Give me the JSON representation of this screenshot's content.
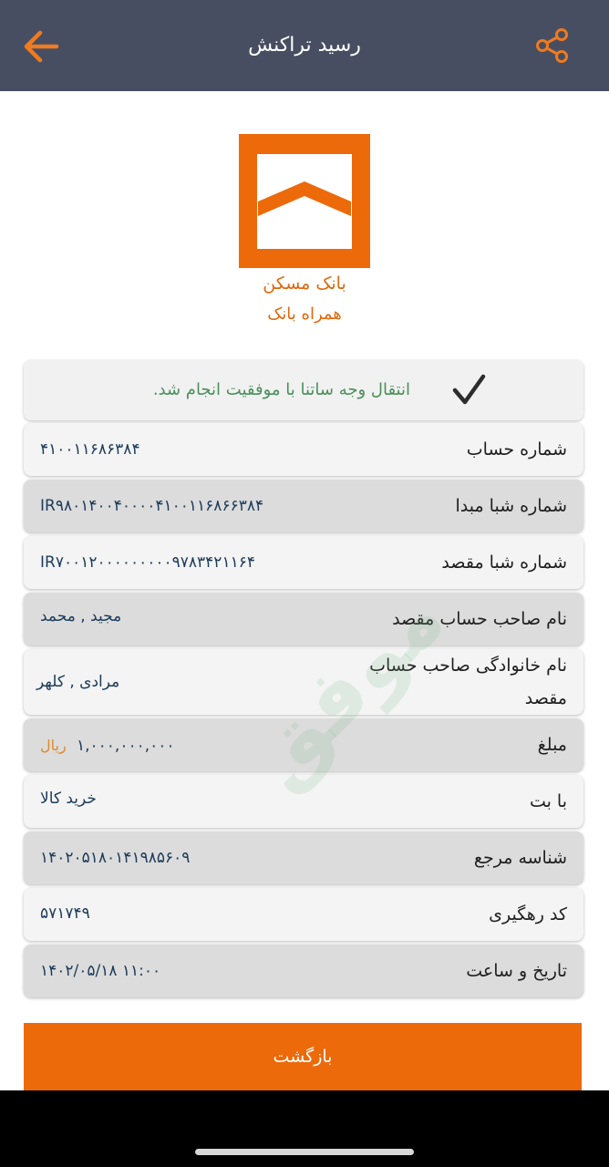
{
  "header": {
    "title": "رسید تراکنش",
    "back_icon": "arrow-left-icon",
    "share_icon": "share-icon"
  },
  "bank": {
    "name": "بانک  مسکن",
    "subtitle": "همراه بانک"
  },
  "status": {
    "message": "انتقال وجه ساتنا با موفقیت انجام شد.",
    "icon": "checkmark-icon"
  },
  "rows": [
    {
      "label": "شماره حساب",
      "value": "۴۱۰۰۱۱۶۸۶۳۸۴"
    },
    {
      "label": "شماره شبا مبدا",
      "value": "IR۹۸۰۱۴۰۰۴۰۰۰۰۴۱۰۰۱۱۶۸۶۶۳۸۴"
    },
    {
      "label": "شماره شبا مقصد",
      "value": "IR۷۰۰۱۲۰۰۰۰۰۰۰۰۰۹۷۸۳۴۲۱۱۶۴"
    },
    {
      "label": "نام صاحب حساب مقصد",
      "value": "مجید , محمد"
    },
    {
      "label": "نام خانوادگی صاحب حساب مقصد",
      "value": "مرادی , کلهر"
    },
    {
      "label": "مبلغ",
      "value": "۱,۰۰۰,۰۰۰,۰۰۰",
      "unit": "ریال"
    },
    {
      "label": "با بت",
      "value": "خرید کالا"
    },
    {
      "label": "شناسه مرجع",
      "value": "۱۴۰۲۰۵۱۸۰۱۴۱۹۸۵۶۰۹"
    },
    {
      "label": "کد رهگیری",
      "value": "۵۷۱۷۴۹"
    },
    {
      "label": "تاریخ و ساعت",
      "value": "۱۴۰۲/۰۵/۱۸ ۱۱:۰۰"
    }
  ],
  "watermark": "موفق",
  "actions": {
    "return_label": "بازگشت"
  },
  "colors": {
    "header_bg": "#474e61",
    "accent": "#ec6a0a",
    "success_text": "#4a8f5a"
  }
}
